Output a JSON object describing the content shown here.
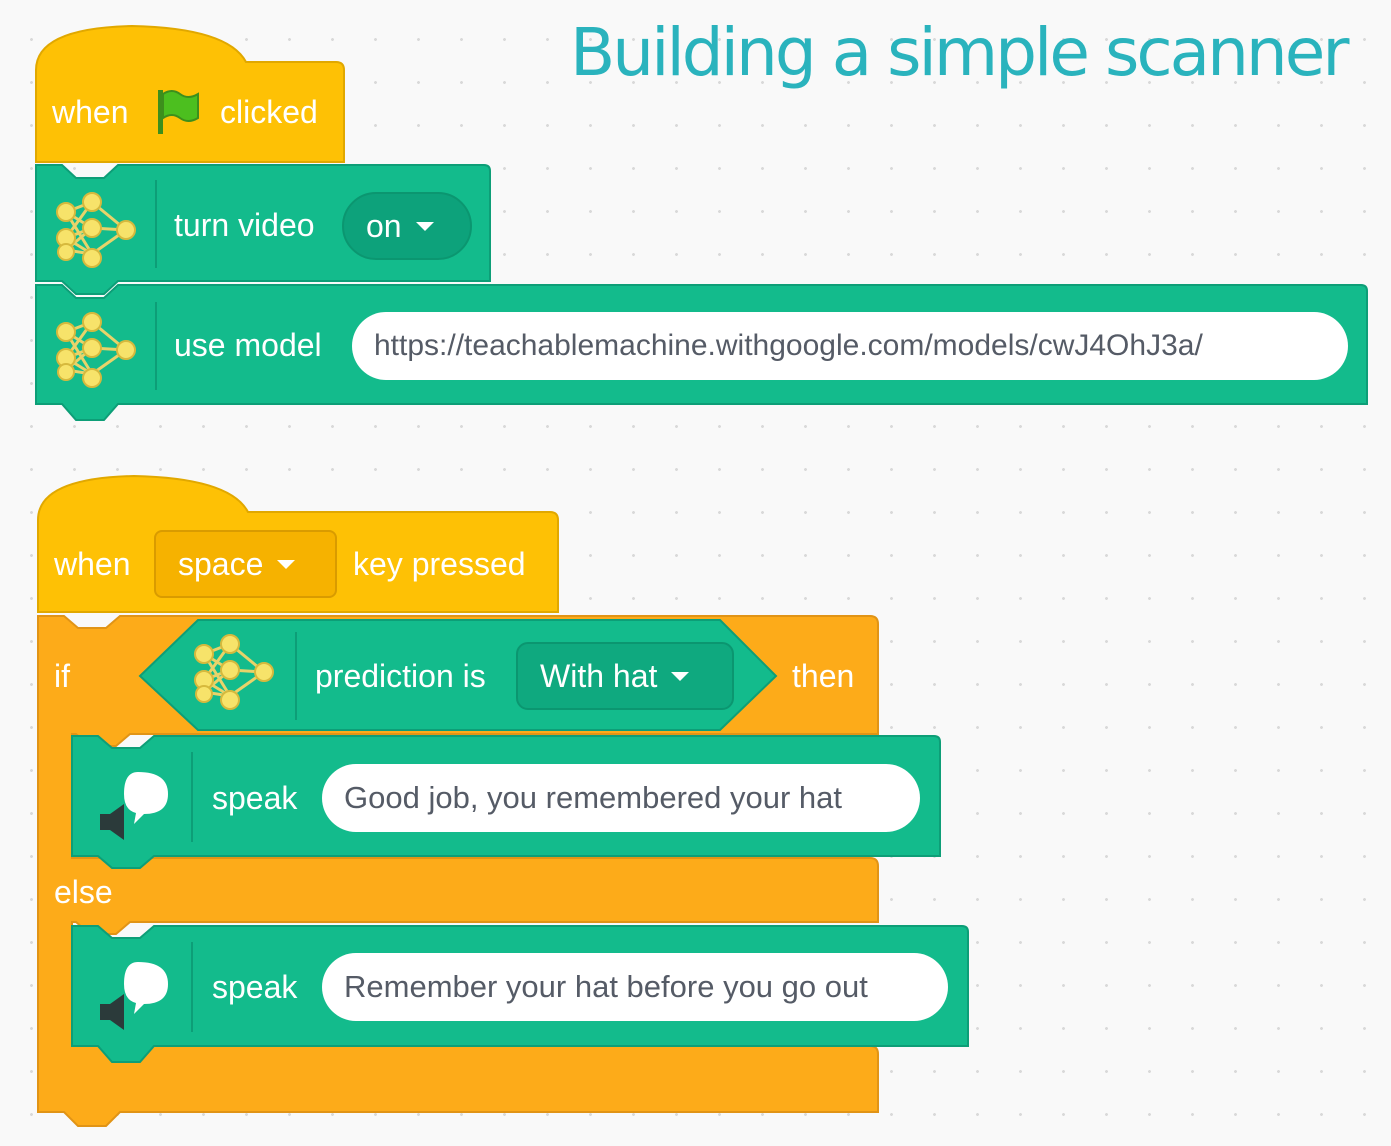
{
  "title": "Building a simple scanner",
  "colors": {
    "event_yellow": "#fec105",
    "control_orange": "#fdab19",
    "ml_green": "#13bb8c",
    "title_teal": "#2ab3bd"
  },
  "script1": {
    "hat": {
      "when": "when",
      "icon": "green-flag-icon",
      "clicked": "clicked"
    },
    "turn_video": {
      "icon": "ml-network-icon",
      "label": "turn video",
      "value": "on"
    },
    "use_model": {
      "icon": "ml-network-icon",
      "label": "use model",
      "url": "https://teachablemachine.withgoogle.com/models/cwJ4OhJ3a/"
    }
  },
  "script2": {
    "hat": {
      "when": "when",
      "key": "space",
      "pressed": "key pressed"
    },
    "if_block": {
      "if": "if",
      "then": "then",
      "else": "else",
      "condition": {
        "icon": "ml-network-icon",
        "label": "prediction is",
        "value": "With hat"
      }
    },
    "speak1": {
      "icon": "speech-bubble-icon",
      "label": "speak",
      "text": "Good job, you remembered your hat"
    },
    "speak2": {
      "icon": "speech-bubble-icon",
      "label": "speak",
      "text": "Remember your hat before you go out"
    }
  }
}
